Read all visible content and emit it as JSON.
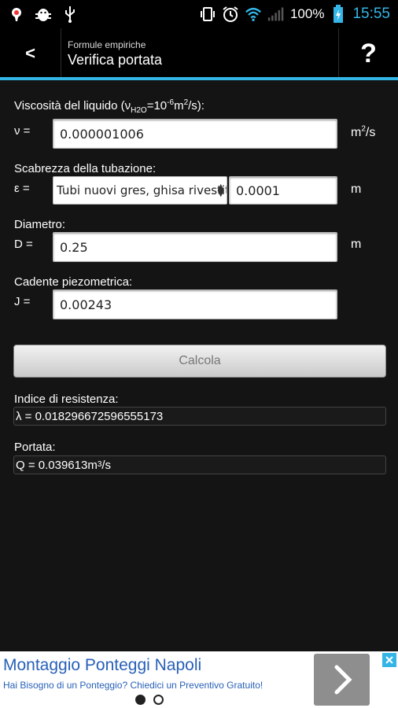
{
  "status_bar": {
    "icons_left": [
      "flashlight-icon",
      "android-debug-icon",
      "usb-icon"
    ],
    "icons_right": [
      "vibrate-icon",
      "alarm-icon",
      "wifi-icon",
      "signal-icon"
    ],
    "battery_percent": "100%",
    "time": "15:55",
    "time_color": "#35b6e8"
  },
  "action_bar": {
    "back_label": "<",
    "subtitle": "Formule empiriche",
    "title": "Verifica portata",
    "help_label": "?",
    "accent": "#33b5e5"
  },
  "form": {
    "viscosity": {
      "label_prefix": "Viscosità del liquido (ν",
      "label_sub": "H2O",
      "label_mid": "=10",
      "label_exp": "-6",
      "label_unit": "m",
      "label_unit_exp": "2",
      "label_suffix": "/s):",
      "symbol": "ν =",
      "value": "0.000001006",
      "unit": "m",
      "unit_exp": "2",
      "unit_suffix": "/s"
    },
    "roughness": {
      "label": "Scabrezza della tubazione:",
      "symbol": "ε =",
      "material": "Tubi nuovi gres, ghisa rivestita",
      "value": "0.0001",
      "unit": "m"
    },
    "diameter": {
      "label": "Diametro:",
      "symbol": "D =",
      "value": "0.25",
      "unit": "m"
    },
    "gradient": {
      "label": "Cadente piezometrica:",
      "symbol": "J =",
      "value": "0.00243"
    },
    "calculate_label": "Calcola"
  },
  "results": {
    "resistance": {
      "label": "Indice di resistenza:",
      "value": "λ = 0.018296672596555173"
    },
    "flow": {
      "label": "Portata:",
      "value_prefix": "Q = 0.039613m",
      "value_exp": "3",
      "value_suffix": "/s"
    }
  },
  "ad": {
    "title": "Montaggio Ponteggi Napoli",
    "description": "Hai Bisogno di un Ponteggio? Chiedici un Preventivo Gratuito!",
    "page_count": 2,
    "active_page": 1
  }
}
